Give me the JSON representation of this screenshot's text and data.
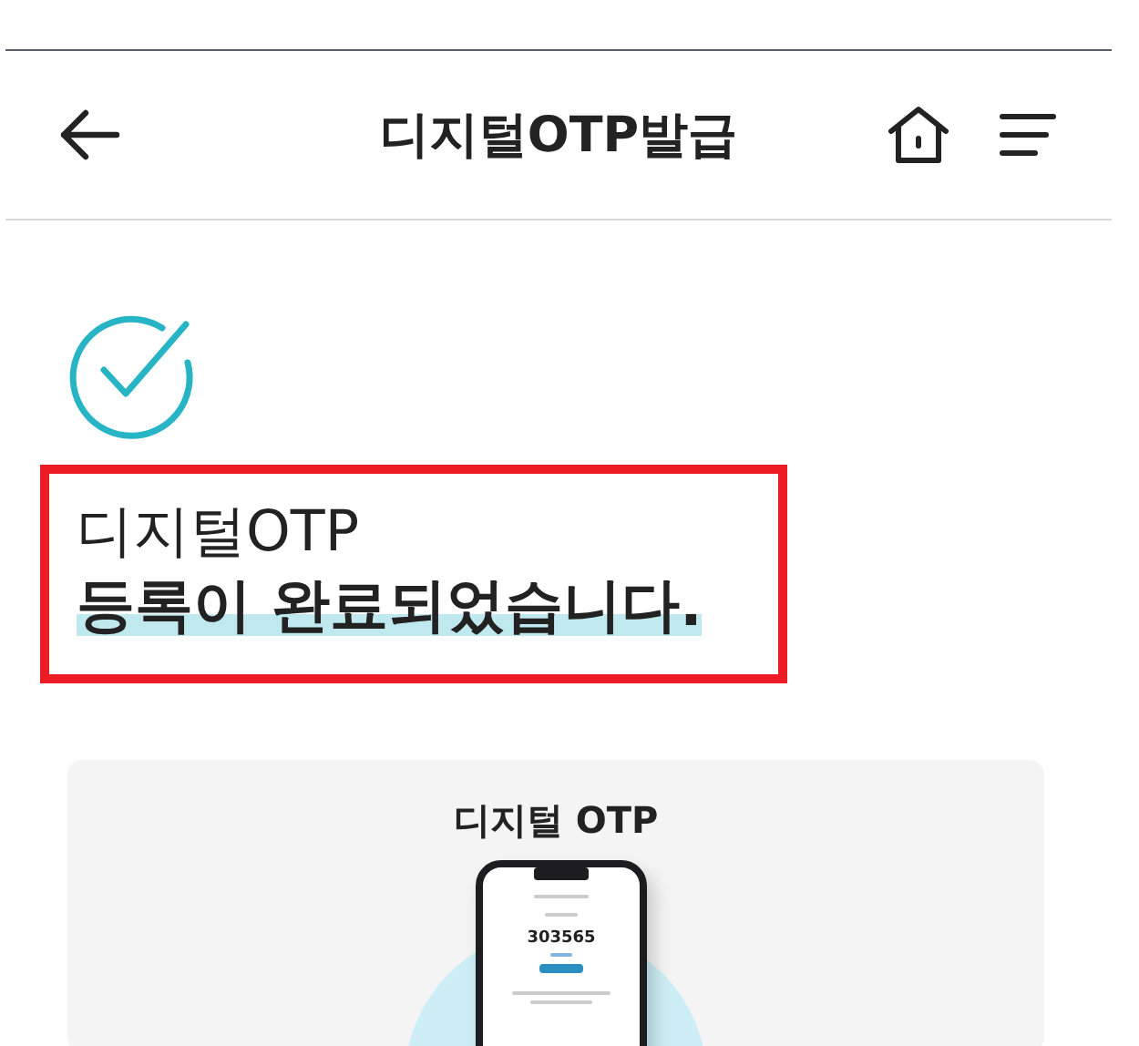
{
  "header": {
    "title": "디지털OTP발급"
  },
  "result": {
    "line_1": "디지털OTP",
    "line_2": "등록이 완료되었습니다.",
    "highlighted": true
  },
  "card": {
    "title": "디지털 OTP",
    "phone_code": "303565"
  }
}
